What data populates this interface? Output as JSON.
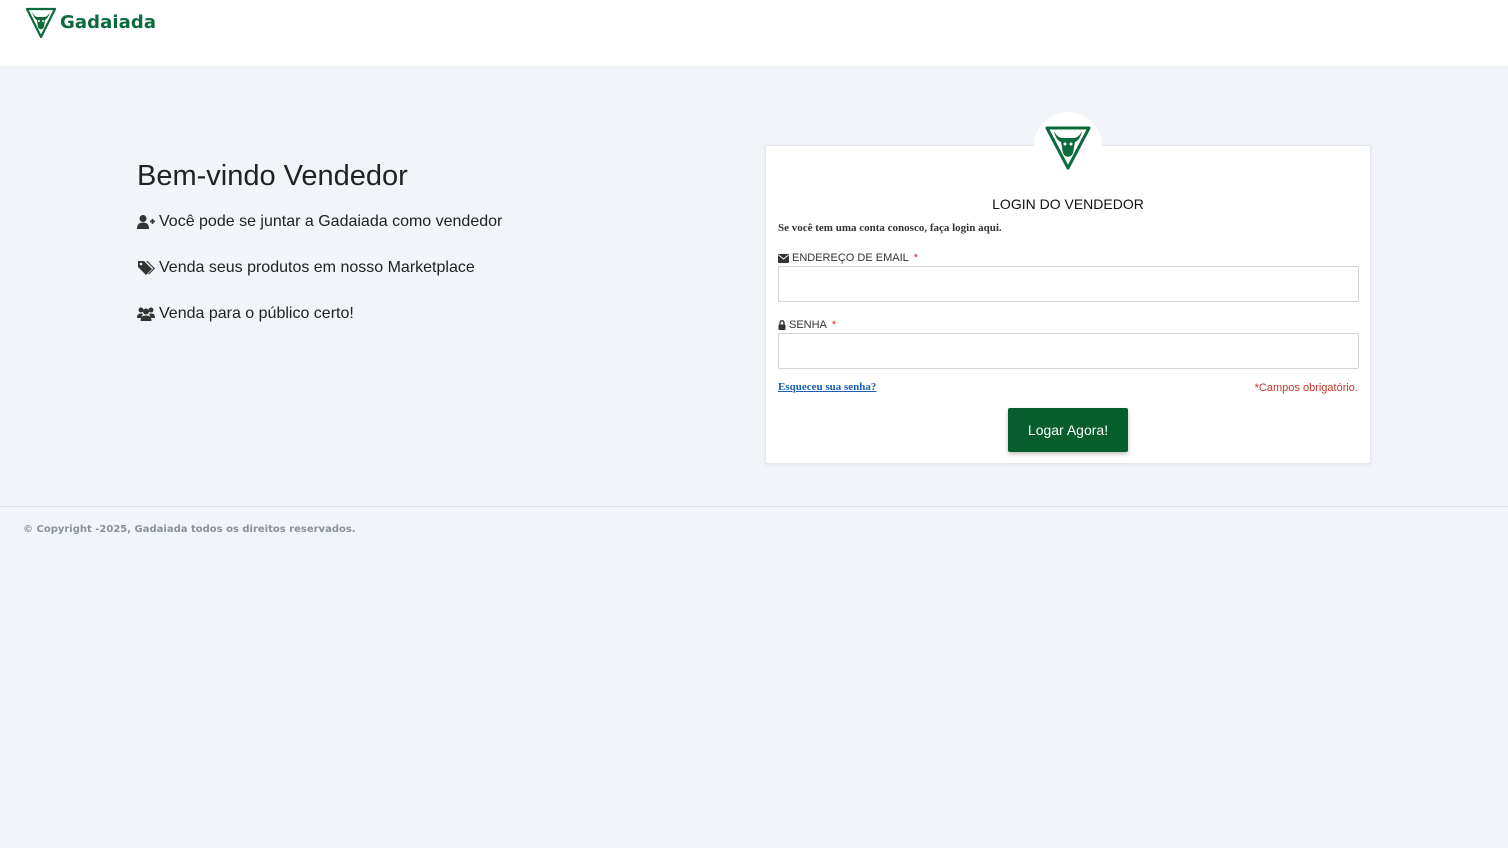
{
  "header": {
    "logo_text": "Gadaiada"
  },
  "welcome": {
    "title": "Bem-vindo Vendedor",
    "features": [
      {
        "icon": "user-plus-icon",
        "text": "Você pode se juntar a Gadaiada como vendedor"
      },
      {
        "icon": "tags-icon",
        "text": "Venda seus produtos em nosso Marketplace"
      },
      {
        "icon": "users-icon",
        "text": "Venda para o público certo!"
      }
    ]
  },
  "login": {
    "title": "LOGIN DO VENDEDOR",
    "subtitle": "Se você tem uma conta conosco, faça login aqui.",
    "email_label": "ENDEREÇO DE EMAIL",
    "email_value": "",
    "password_label": "SENHA",
    "password_value": "",
    "required_mark": "*",
    "forgot_link": "Esqueceu sua senha?",
    "required_note": "*Campos obrigatório.",
    "submit_label": "Logar Agora!"
  },
  "footer": {
    "copyright": "© Copyright -2025, Gadaiada todos os direitos reservados."
  },
  "colors": {
    "brand_green": "#075e2d",
    "page_background": "#f1f4f8",
    "link_blue": "#1a5fb4",
    "required_red": "#c0392b"
  }
}
